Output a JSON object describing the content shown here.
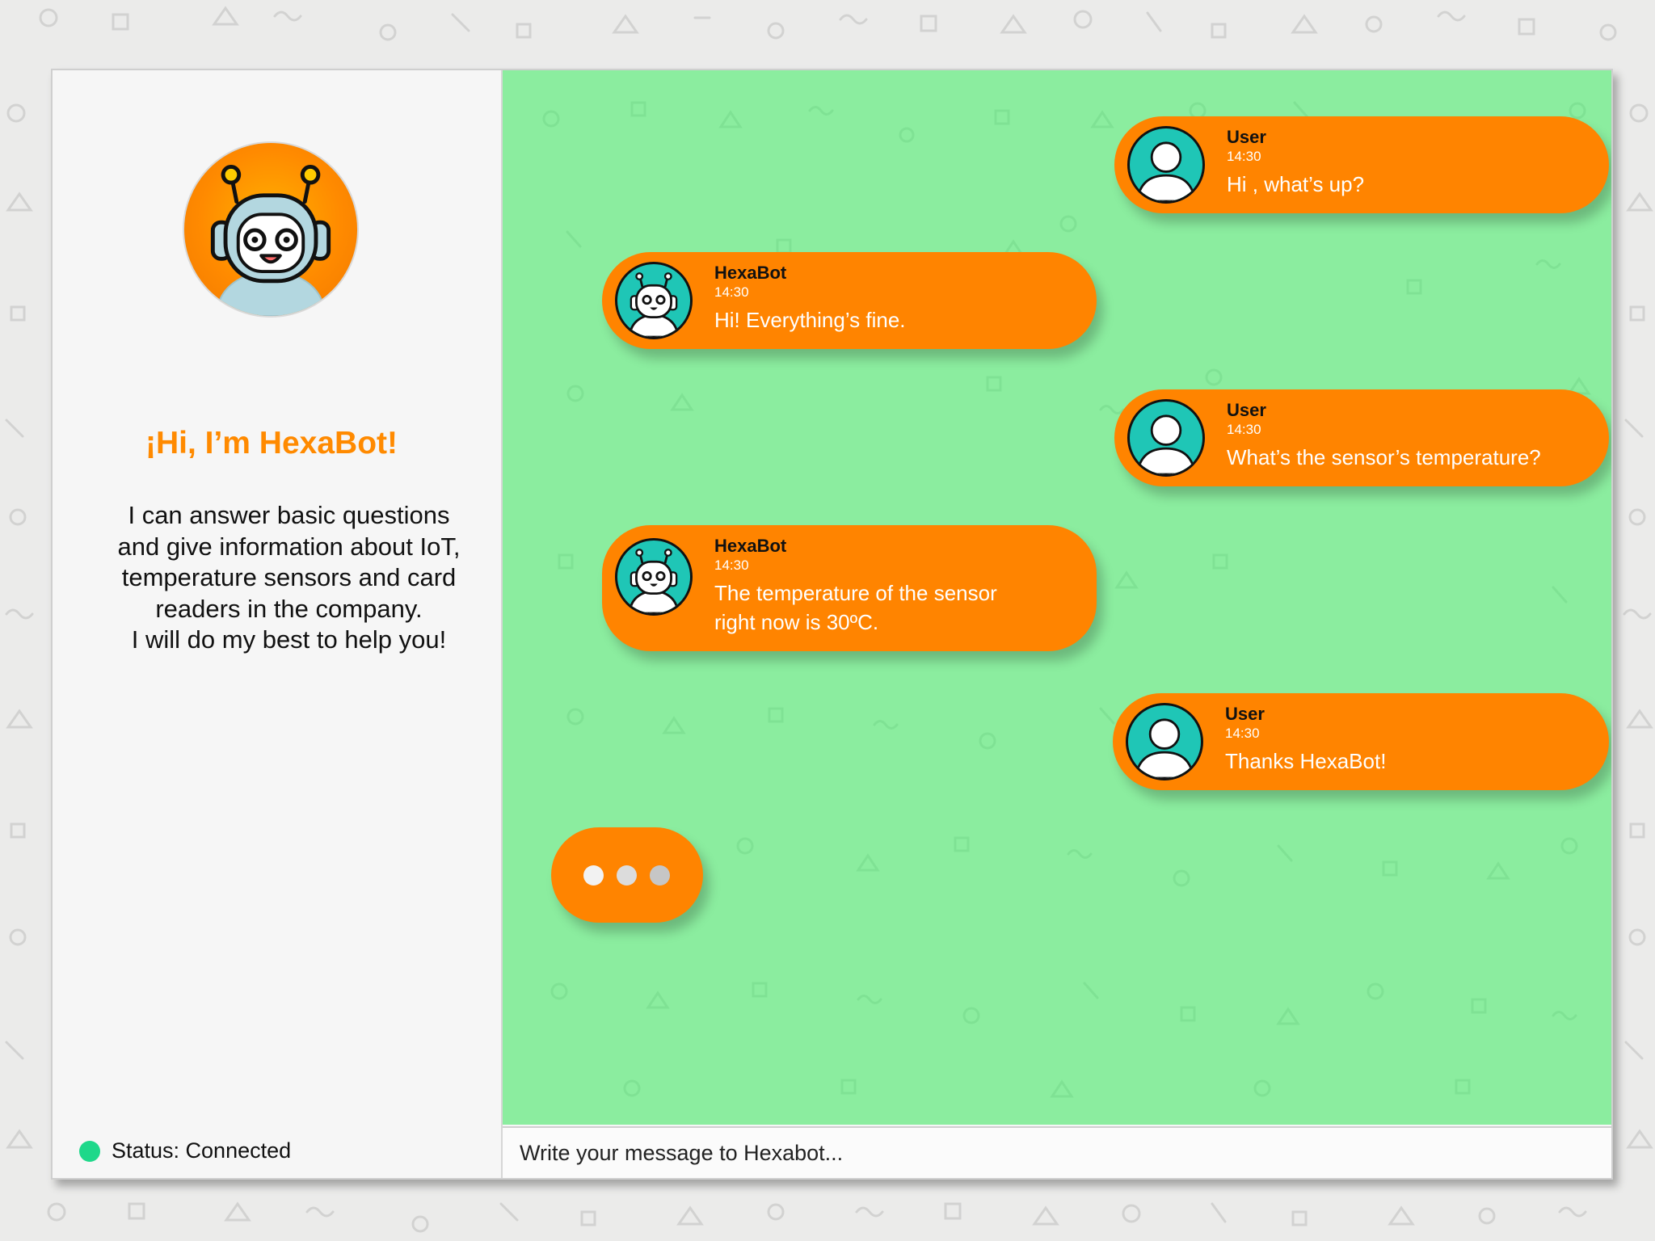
{
  "colors": {
    "accent": "#ff8400",
    "chat_background": "#8bed9f",
    "avatar_teal": "#1fc6b6",
    "status_green": "#1ed88a",
    "greeting": "#ff8a00"
  },
  "sidebar": {
    "bot_avatar_icon": "robot-icon",
    "greeting": "¡Hi, I’m HexaBot!",
    "intro": [
      "I can answer basic questions",
      "and give information about IoT,",
      "temperature sensors and card",
      "readers in the company.",
      "I will do my best to help you!"
    ],
    "status_text": "Status: Connected"
  },
  "chat": {
    "messages": [
      {
        "from": "user",
        "sender": "User",
        "time": "14:30",
        "text": [
          "Hi , what’s up?"
        ],
        "avatar_icon": "user-icon"
      },
      {
        "from": "bot",
        "sender": "HexaBot",
        "time": "14:30",
        "text": [
          "Hi! Everything’s fine."
        ],
        "avatar_icon": "robot-icon"
      },
      {
        "from": "user",
        "sender": "User",
        "time": "14:30",
        "text": [
          "What’s the sensor’s temperature?"
        ],
        "avatar_icon": "user-icon"
      },
      {
        "from": "bot",
        "sender": "HexaBot",
        "time": "14:30",
        "text": [
          "The temperature of the sensor",
          "right now is 30ºC."
        ],
        "avatar_icon": "robot-icon"
      },
      {
        "from": "user",
        "sender": "User",
        "time": "14:30",
        "text": [
          "Thanks HexaBot!"
        ],
        "avatar_icon": "user-icon"
      }
    ],
    "typing_indicator": {
      "dots": [
        "#f2f2f2",
        "#dcdcdc",
        "#c6c6c6"
      ]
    }
  },
  "input": {
    "placeholder": "Write your message to Hexabot..."
  }
}
